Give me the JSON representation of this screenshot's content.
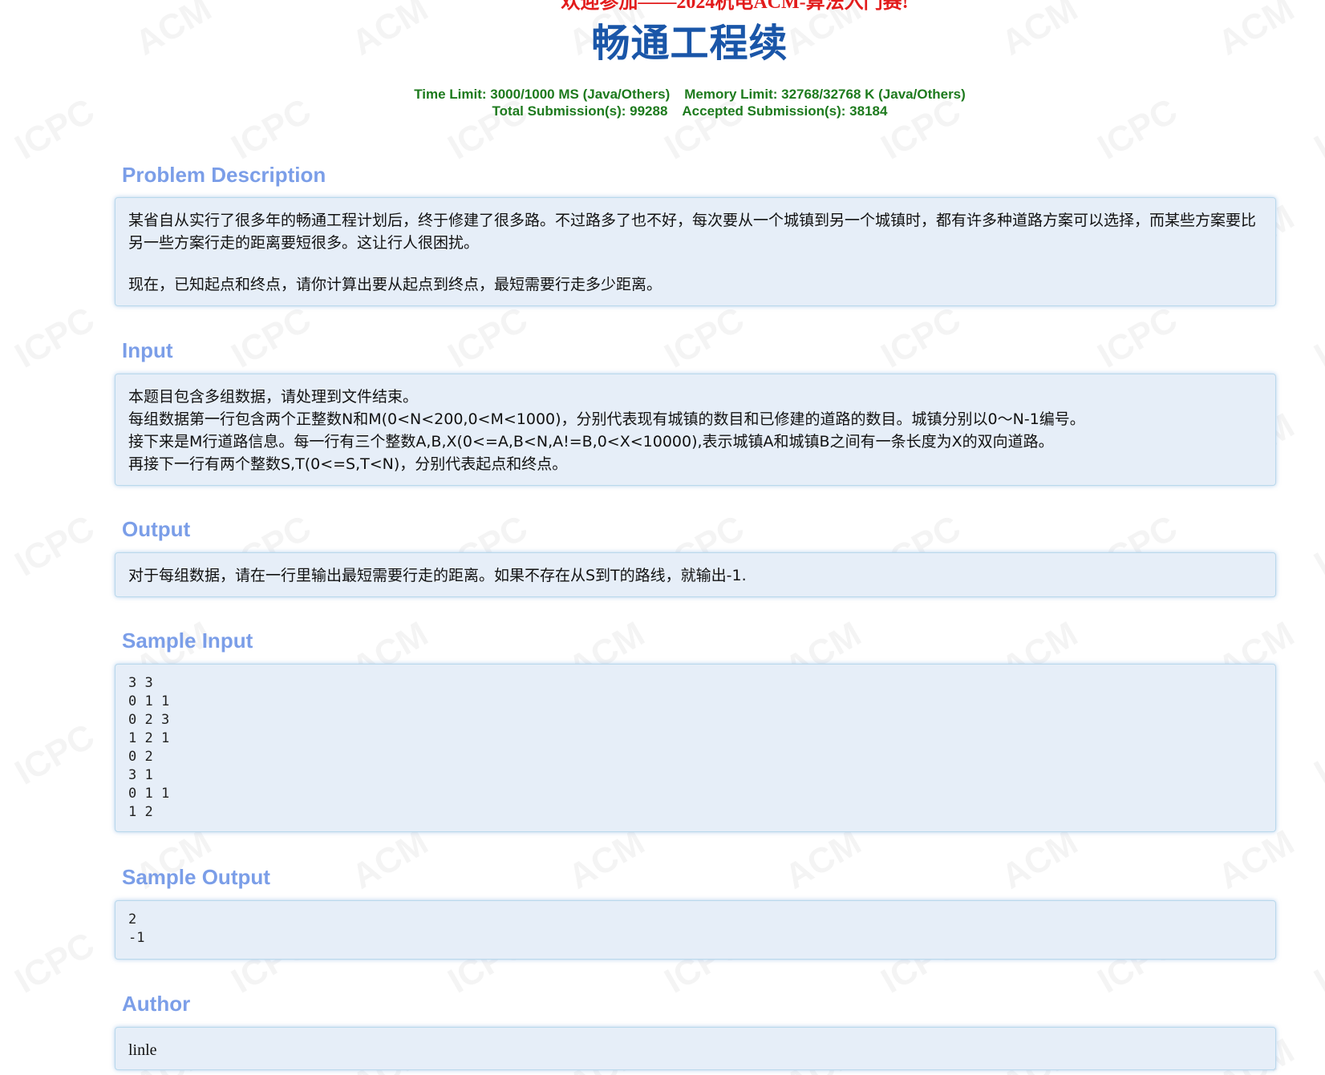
{
  "banner": "欢迎参加——2024杭电ACM-算法入门赛!",
  "title": "畅通工程续",
  "limits": {
    "time": "Time Limit: 3000/1000 MS (Java/Others)",
    "memory": "Memory Limit: 32768/32768 K (Java/Others)",
    "total": "Total Submission(s): 99288",
    "accepted": "Accepted Submission(s): 38184"
  },
  "watermark": {
    "acm": "ACM",
    "icpc": "ICPC"
  },
  "sections": {
    "description": {
      "title": "Problem Description",
      "p1": "某省自从实行了很多年的畅通工程计划后，终于修建了很多路。不过路多了也不好，每次要从一个城镇到另一个城镇时，都有许多种道路方案可以选择，而某些方案要比另一些方案行走的距离要短很多。这让行人很困扰。",
      "p2": "现在，已知起点和终点，请你计算出要从起点到终点，最短需要行走多少距离。"
    },
    "input": {
      "title": "Input",
      "lines": [
        "本题目包含多组数据，请处理到文件结束。",
        "每组数据第一行包含两个正整数N和M(0<N<200,0<M<1000)，分别代表现有城镇的数目和已修建的道路的数目。城镇分别以0～N-1编号。",
        "接下来是M行道路信息。每一行有三个整数A,B,X(0<=A,B<N,A!=B,0<X<10000),表示城镇A和城镇B之间有一条长度为X的双向道路。",
        "再接下一行有两个整数S,T(0<=S,T<N)，分别代表起点和终点。"
      ]
    },
    "output": {
      "title": "Output",
      "text": "对于每组数据，请在一行里输出最短需要行走的距离。如果不存在从S到T的路线，就输出-1."
    },
    "sample_input": {
      "title": "Sample Input",
      "text": "3 3\n0 1 1\n0 2 3\n1 2 1\n0 2\n3 1\n0 1 1\n1 2"
    },
    "sample_output": {
      "title": "Sample Output",
      "text": "2\n-1"
    },
    "author": {
      "title": "Author",
      "text": "linle"
    }
  }
}
